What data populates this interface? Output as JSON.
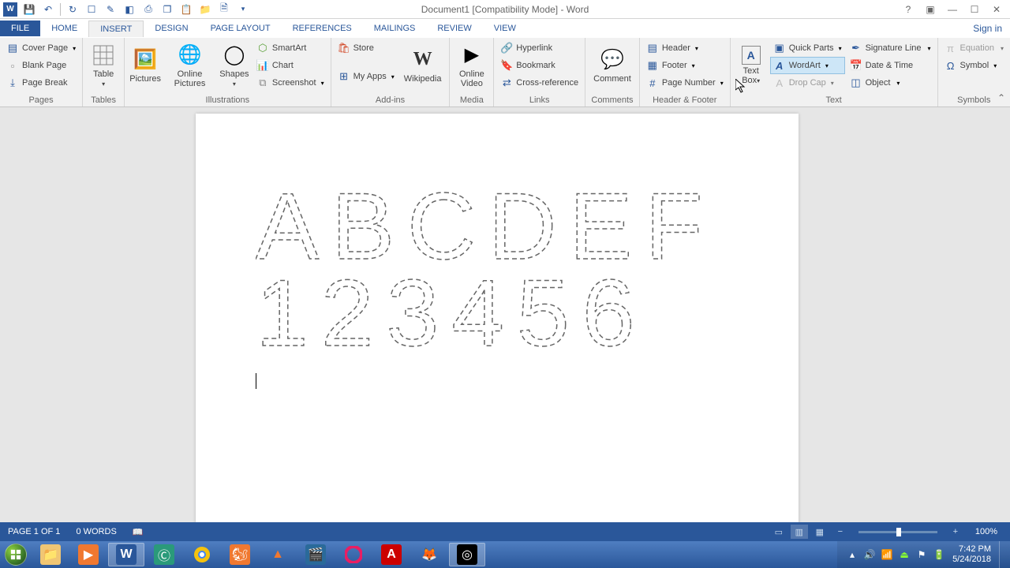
{
  "title": "Document1 [Compatibility Mode] - Word",
  "signin": "Sign in",
  "qat": {
    "icons": [
      "word-icon",
      "save-icon",
      "undo-icon",
      "redo-icon",
      "new-icon",
      "edit-icon",
      "preview-icon",
      "print-icon",
      "copy-icon",
      "paste-icon",
      "open-icon",
      "page-icon",
      "more-icon"
    ]
  },
  "tabs": {
    "file": "FILE",
    "items": [
      "HOME",
      "INSERT",
      "DESIGN",
      "PAGE LAYOUT",
      "REFERENCES",
      "MAILINGS",
      "REVIEW",
      "VIEW"
    ],
    "active": "INSERT"
  },
  "ribbon": {
    "pages": {
      "label": "Pages",
      "cover": "Cover Page",
      "blank": "Blank Page",
      "break": "Page Break"
    },
    "tables": {
      "label": "Tables",
      "table": "Table"
    },
    "illustrations": {
      "label": "Illustrations",
      "pictures": "Pictures",
      "online_pictures": "Online Pictures",
      "shapes": "Shapes",
      "smartart": "SmartArt",
      "chart": "Chart",
      "screenshot": "Screenshot"
    },
    "addins": {
      "label": "Add-ins",
      "store": "Store",
      "myapps": "My Apps",
      "wikipedia": "Wikipedia"
    },
    "media": {
      "label": "Media",
      "video": "Online Video"
    },
    "links": {
      "label": "Links",
      "hyperlink": "Hyperlink",
      "bookmark": "Bookmark",
      "crossref": "Cross-reference"
    },
    "comments": {
      "label": "Comments",
      "comment": "Comment"
    },
    "headerfooter": {
      "label": "Header & Footer",
      "header": "Header",
      "footer": "Footer",
      "pagenum": "Page Number"
    },
    "text": {
      "label": "Text",
      "textbox": "Text Box",
      "quickparts": "Quick Parts",
      "wordart": "WordArt",
      "dropcap": "Drop Cap",
      "sigline": "Signature Line",
      "datetime": "Date & Time",
      "object": "Object"
    },
    "symbols": {
      "label": "Symbols",
      "equation": "Equation",
      "symbol": "Symbol"
    }
  },
  "document": {
    "line1": "ABCDEF",
    "line2": "123456"
  },
  "status": {
    "page": "PAGE 1 OF 1",
    "words": "0 WORDS",
    "zoom": "100%"
  },
  "tray": {
    "time": "7:42 PM",
    "date": "5/24/2018"
  }
}
